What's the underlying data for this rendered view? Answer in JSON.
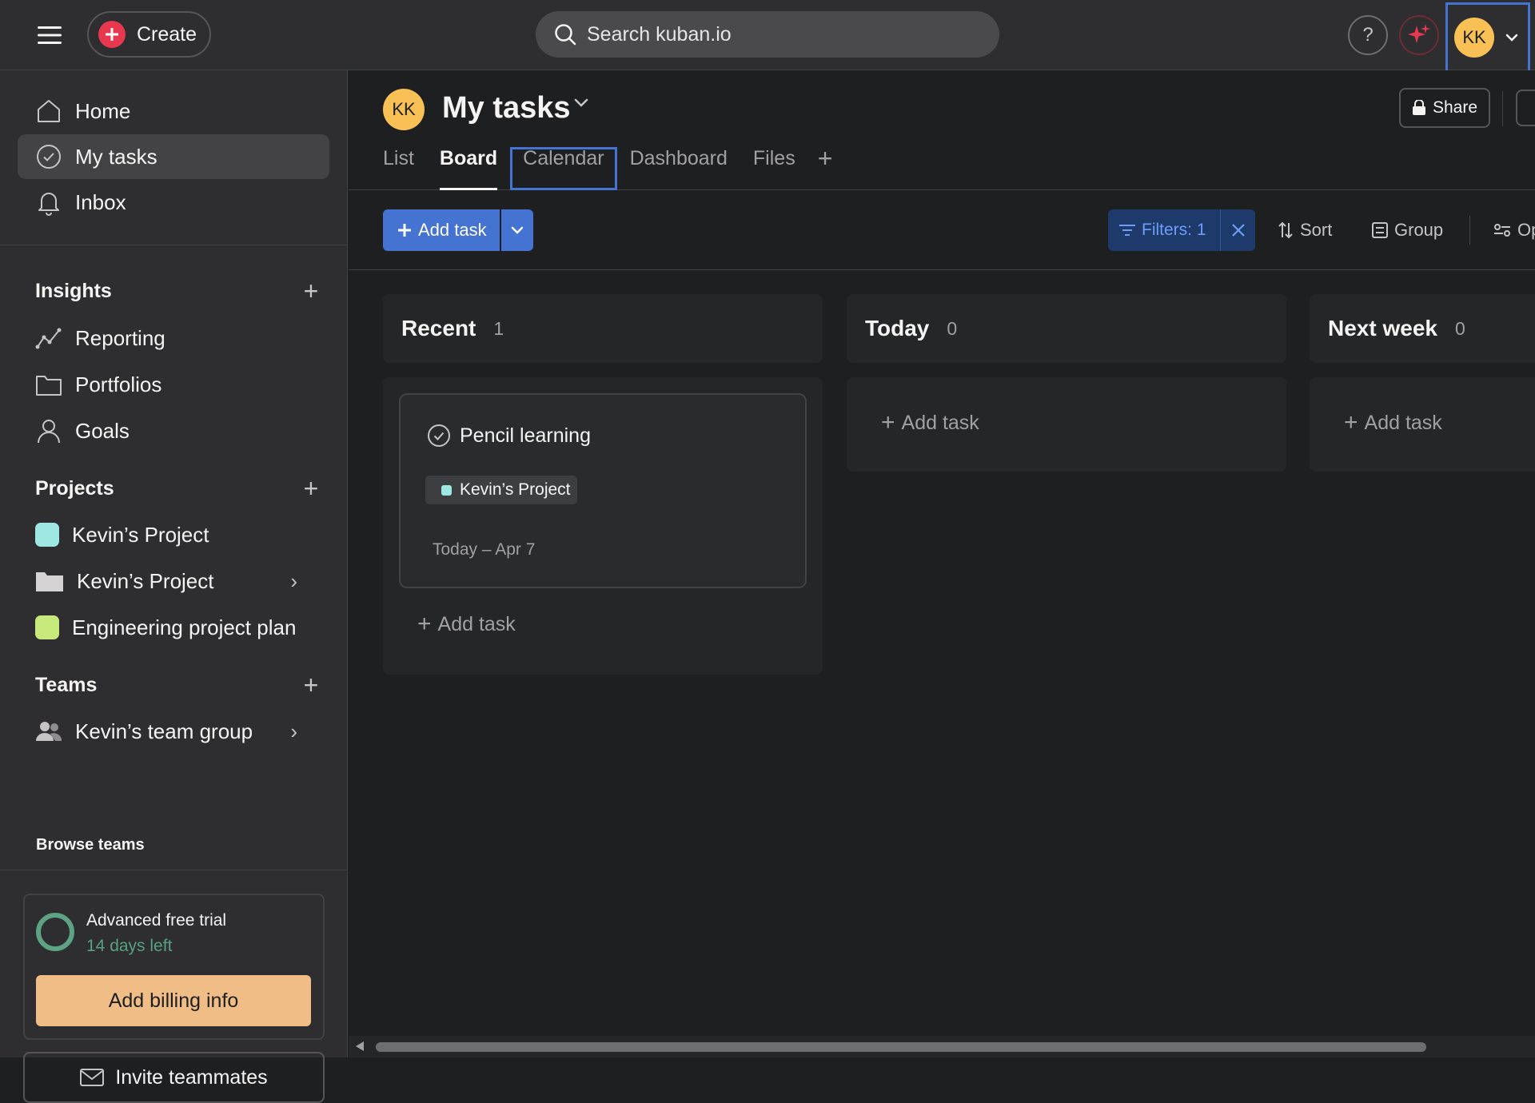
{
  "topbar": {
    "create_label": "Create",
    "search_placeholder": "Search kuban.io",
    "help_label": "?",
    "avatar_initials": "KK"
  },
  "sidebar": {
    "nav": [
      {
        "label": "Home",
        "icon": "home-icon"
      },
      {
        "label": "My tasks",
        "icon": "check-circle-icon",
        "active": true
      },
      {
        "label": "Inbox",
        "icon": "bell-icon"
      }
    ],
    "insights": {
      "title": "Insights",
      "items": [
        {
          "label": "Reporting",
          "icon": "chart-line-icon"
        },
        {
          "label": "Portfolios",
          "icon": "folder-icon"
        },
        {
          "label": "Goals",
          "icon": "person-icon"
        }
      ]
    },
    "projects": {
      "title": "Projects",
      "items": [
        {
          "label": "Kevin’s Project",
          "color": "#9ee7e3"
        },
        {
          "label": "Kevin’s Project",
          "icon": "folder-filled-icon"
        },
        {
          "label": "Engineering project plan",
          "color": "#c7e87a"
        }
      ]
    },
    "teams": {
      "title": "Teams",
      "items": [
        {
          "label": "Kevin’s team group",
          "icon": "team-icon"
        }
      ],
      "browse_label": "Browse teams"
    },
    "trial": {
      "title": "Advanced free trial",
      "days_left": "14 days left",
      "billing_label": "Add billing info"
    },
    "invite_label": "Invite teammates"
  },
  "page": {
    "avatar_initials": "KK",
    "title": "My tasks",
    "share_label": "Share",
    "tabs": [
      "List",
      "Board",
      "Calendar",
      "Dashboard",
      "Files"
    ],
    "active_tab": "Board"
  },
  "toolbar": {
    "add_task_label": "Add task",
    "filter_label": "Filters: 1",
    "sort_label": "Sort",
    "group_label": "Group",
    "options_label": "Op"
  },
  "board": {
    "columns": [
      {
        "title": "Recent",
        "count": "1",
        "tasks": [
          {
            "name": "Pencil learning",
            "project": "Kevin’s Project",
            "project_color": "#9ee7e3",
            "date": "Today – Apr 7"
          }
        ],
        "add_label": "Add task"
      },
      {
        "title": "Today",
        "count": "0",
        "tasks": [],
        "add_label": "Add task"
      },
      {
        "title": "Next week",
        "count": "0",
        "tasks": [],
        "add_label": "Add task"
      }
    ]
  },
  "colors": {
    "accent_blue": "#4573d2",
    "brand_red": "#e8384f",
    "avatar_yellow": "#f8c055",
    "billing_orange": "#f1bd87",
    "trial_green": "#5da283"
  }
}
